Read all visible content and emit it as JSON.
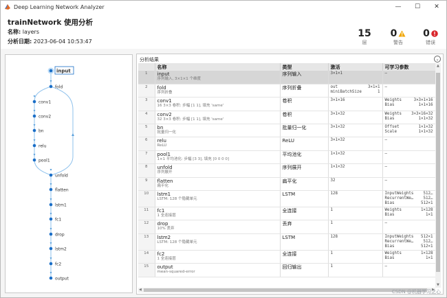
{
  "window": {
    "title": "Deep Learning Network Analyzer",
    "min_glyph": "—",
    "max_glyph": "☐",
    "close_glyph": "✕"
  },
  "header": {
    "title": "trainNetwork 使用分析",
    "name_label": "名称:",
    "name_value": "layers",
    "date_label": "分析日期:",
    "date_value": "2023-06-04 10:53:47"
  },
  "stats": [
    {
      "value": "15",
      "label": "层",
      "icon": "none"
    },
    {
      "value": "0",
      "label": "警告",
      "icon": "warning-icon"
    },
    {
      "value": "0",
      "label": "错误",
      "icon": "error-icon"
    }
  ],
  "colors": {
    "accent": "#1a6ec7",
    "warning": "#f0a500",
    "error": "#d9262c",
    "selected_row": "#d6d6d6"
  },
  "results": {
    "title": "分析结果",
    "columns": [
      "",
      "名称",
      "类型",
      "激活",
      "可学习参数"
    ],
    "rows": [
      {
        "idx": "1",
        "name": "input",
        "desc": "序列输入, 3×1×1 个维度",
        "type": "序列输入",
        "act": [
          "3×1×1"
        ],
        "params": [
          "–"
        ]
      },
      {
        "idx": "2",
        "name": "fold",
        "desc": "序列折叠",
        "type": "序列折叠",
        "act": [
          "out",
          "miniBatchSize"
        ],
        "act_r": [
          "3×1×1",
          "1"
        ],
        "params": [
          "–"
        ]
      },
      {
        "idx": "3",
        "name": "conv1",
        "desc": "16 3×3 卷积: 步幅 [1 1], 填充 'same'",
        "type": "卷积",
        "act": [
          "3×1×16"
        ],
        "params": [
          "Weights",
          "Bias"
        ],
        "params_r": [
          "3×3×1×16",
          "1×1×16"
        ]
      },
      {
        "idx": "4",
        "name": "conv2",
        "desc": "32 3×3 卷积: 步幅 [1 1], 填充 'same'",
        "type": "卷积",
        "act": [
          "3×1×32"
        ],
        "params": [
          "Weights",
          "Bias"
        ],
        "params_r": [
          "3×3×16×32",
          "1×1×32"
        ]
      },
      {
        "idx": "5",
        "name": "bn",
        "desc": "批量归一化",
        "type": "批量归一化",
        "act": [
          "3×1×32"
        ],
        "params": [
          "Offset",
          "Scale"
        ],
        "params_r": [
          "1×1×32",
          "1×1×32"
        ]
      },
      {
        "idx": "6",
        "name": "relu",
        "desc": "ReLU",
        "type": "ReLU",
        "act": [
          "3×1×32"
        ],
        "params": [
          "–"
        ]
      },
      {
        "idx": "7",
        "name": "pool1",
        "desc": "1×1 平均池化: 步幅 [3 3], 填充 [0 0 0 0]",
        "type": "平均池化",
        "act": [
          "1×1×32"
        ],
        "params": [
          "–"
        ]
      },
      {
        "idx": "8",
        "name": "unfold",
        "desc": "序列展开",
        "type": "序列展开",
        "act": [
          "1×1×32"
        ],
        "params": [
          "–"
        ]
      },
      {
        "idx": "9",
        "name": "flatten",
        "desc": "扁平化",
        "type": "扁平化",
        "act": [
          "32"
        ],
        "params": [
          "–"
        ]
      },
      {
        "idx": "10",
        "name": "lstm1",
        "desc": "LSTM: 128 个隐藏单元",
        "type": "LSTM",
        "act": [
          "128"
        ],
        "params": [
          "InputWeights",
          "RecurrentWe…",
          "Bias"
        ],
        "params_r": [
          "512…",
          "512…",
          "512×1"
        ]
      },
      {
        "idx": "11",
        "name": "fc1",
        "desc": "1 全连接层",
        "type": "全连接",
        "act": [
          "1"
        ],
        "params": [
          "Weights",
          "Bias"
        ],
        "params_r": [
          "1×128",
          "1×1"
        ]
      },
      {
        "idx": "12",
        "name": "drop",
        "desc": "10% 丢弃",
        "type": "丢弃",
        "act": [
          "1"
        ],
        "params": [
          "–"
        ]
      },
      {
        "idx": "13",
        "name": "lstm2",
        "desc": "LSTM: 128 个隐藏单元",
        "type": "LSTM",
        "act": [
          "128"
        ],
        "params": [
          "InputWeights",
          "RecurrentWe…",
          "Bias"
        ],
        "params_r": [
          "512×1",
          "512…",
          "512×1"
        ]
      },
      {
        "idx": "14",
        "name": "fc2",
        "desc": "1 全连接层",
        "type": "全连接",
        "act": [
          "1"
        ],
        "params": [
          "Weights",
          "Bias"
        ],
        "params_r": [
          "1×128",
          "1×1"
        ]
      },
      {
        "idx": "15",
        "name": "output",
        "desc": "mean-squared-error",
        "type": "回归输出",
        "act": [
          "1"
        ],
        "params": [
          "–"
        ]
      }
    ]
  },
  "graph": {
    "nodes": [
      "input",
      "fold",
      "conv1",
      "conv2",
      "bn",
      "relu",
      "pool1",
      "unfold",
      "flatten",
      "lstm1",
      "fc1",
      "drop",
      "lstm2",
      "fc2",
      "output"
    ]
  },
  "watermark": "CSDN @机器学习之心"
}
